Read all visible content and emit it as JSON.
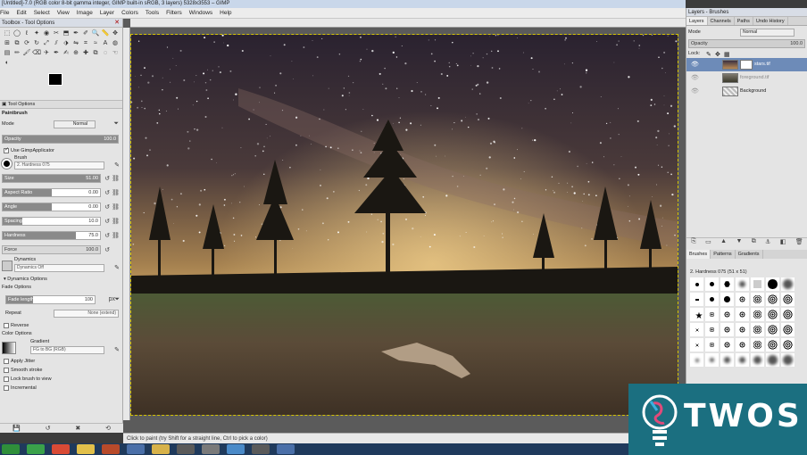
{
  "window": {
    "title": "[Untitled]-7.0 (RGB color 8-bit gamma integer, GIMP built-in sRGB, 3 layers) 5328x3553 – GIMP"
  },
  "menu": [
    "File",
    "Edit",
    "Select",
    "View",
    "Image",
    "Layer",
    "Colors",
    "Tools",
    "Filters",
    "Windows",
    "Help"
  ],
  "toolbox": {
    "title": "Toolbox - Tool Options",
    "tool_icons": [
      "rect-select",
      "ellipse-select",
      "free-select",
      "fuzzy-select",
      "select-by-color",
      "scissors",
      "foreground-select",
      "paths",
      "color-picker",
      "zoom",
      "measure",
      "move",
      "align",
      "crop",
      "unified-transform",
      "rotate",
      "scale",
      "shear",
      "perspective",
      "flip",
      "cage",
      "warp",
      "text",
      "bucket-fill",
      "gradient",
      "pencil",
      "paintbrush",
      "eraser",
      "airbrush",
      "ink",
      "mypaint",
      "clone",
      "heal",
      "perspective-clone",
      "blur",
      "smudge",
      "dodge-burn"
    ],
    "tab_label": "Tool Options",
    "tool_name": "Paintbrush",
    "mode_label": "Mode",
    "mode_value": "Normal",
    "opacity_label": "Opacity",
    "opacity_value": "100.0",
    "use_applicator": "Use GimpApplicator",
    "brush_label": "Brush",
    "brush_value": "2. Hardness 075",
    "size_label": "Size",
    "size_value": "51.00",
    "aspect_label": "Aspect Ratio",
    "aspect_value": "0.00",
    "angle_label": "Angle",
    "angle_value": "0.00",
    "spacing_label": "Spacing",
    "spacing_value": "10.0",
    "hardness_label": "Hardness",
    "hardness_value": "75.0",
    "force_label": "Force",
    "force_value": "100.0",
    "dynamics_label": "Dynamics",
    "dynamics_value": "Dynamics Off",
    "dynamics_options": "Dynamics Options",
    "fade_options": "Fade Options",
    "fade_length_label": "Fade length",
    "fade_length_value": "100",
    "fade_unit": "px",
    "repeat_label": "Repeat",
    "repeat_value": "None (extend)",
    "reverse_label": "Reverse",
    "color_options": "Color Options",
    "gradient_label": "Gradient",
    "gradient_value": "FG to BG (RGB)",
    "apply_jitter": "Apply Jitter",
    "smooth_stroke": "Smooth stroke",
    "lock_brush": "Lock brush to view",
    "incremental": "Incremental"
  },
  "status": {
    "text": "Click to paint (try Shift for a straight line, Ctrl to pick a color)"
  },
  "layers_panel": {
    "title": "Layers - Brushes",
    "tabs": [
      "Layers",
      "Channels",
      "Paths",
      "Undo History"
    ],
    "mode_label": "Mode",
    "mode_value": "Normal",
    "opacity_label": "Opacity",
    "opacity_value": "100.0",
    "lock_label": "Lock:",
    "layers": [
      {
        "name": "stars.tif",
        "selected": true
      },
      {
        "name": "foreground.tif",
        "selected": false
      },
      {
        "name": "Background",
        "selected": false
      }
    ],
    "brush_tabs": [
      "Brushes",
      "Patterns",
      "Gradients"
    ],
    "brush_name": "2. Hardness 075 (51 x 51)"
  },
  "watermark": {
    "text": "TWOS"
  },
  "colors": {
    "selected_layer": "#6d8bb8",
    "watermark_bg": "#1b6f80",
    "taskbar": "#1f3a5c"
  }
}
